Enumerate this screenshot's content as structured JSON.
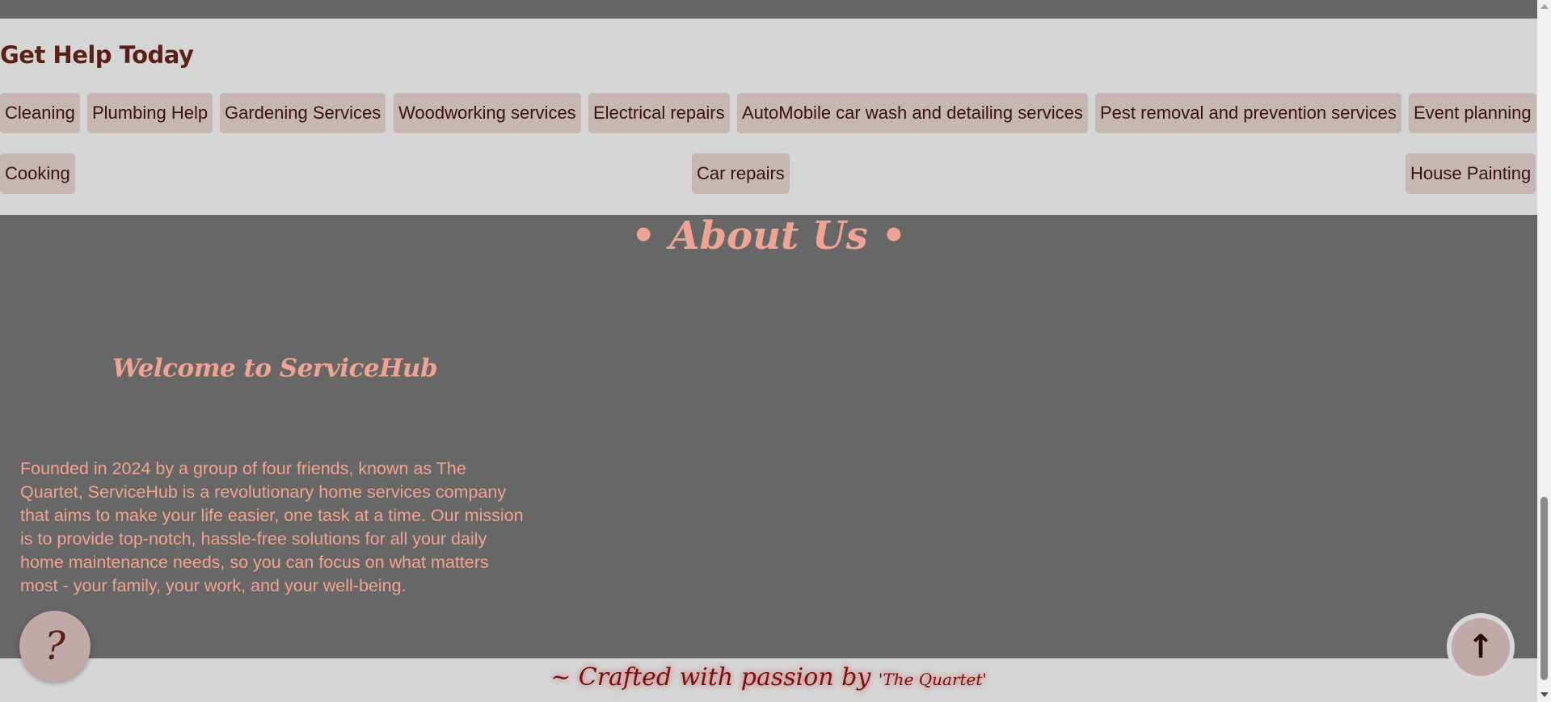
{
  "help": {
    "title": "Get Help Today",
    "services": [
      "Cleaning",
      "Plumbing Help",
      "Gardening Services",
      "Woodworking services",
      "Electrical repairs",
      "AutoMobile car wash and detailing services",
      "Pest removal and prevention services",
      "Event planning",
      "Cooking",
      "Car repairs",
      "House Painting"
    ]
  },
  "about": {
    "title": "• About Us •",
    "welcome": "Welcome to ServiceHub",
    "description": "Founded in 2024 by a group of four friends, known as The Quartet, ServiceHub is a revolutionary home services company that aims to make your life easier, one task at a time. Our mission is to provide top-notch, hassle-free solutions for all your daily home maintenance needs, so you can focus on what matters most - your family, your work, and your well-being."
  },
  "footer": {
    "text": "~ Crafted with passion by ",
    "signature": "'The Quartet'"
  },
  "buttons": {
    "help_symbol": "?",
    "top_symbol": "↑"
  },
  "icons": {
    "help": "question-mark-icon",
    "top": "arrow-up-icon"
  },
  "colors": {
    "accent": "#f0a392",
    "chip_bg": "#c6b6b4",
    "dark_text": "#5a1f16",
    "section_bg": "#d5d5d5",
    "page_bg": "#676767"
  }
}
